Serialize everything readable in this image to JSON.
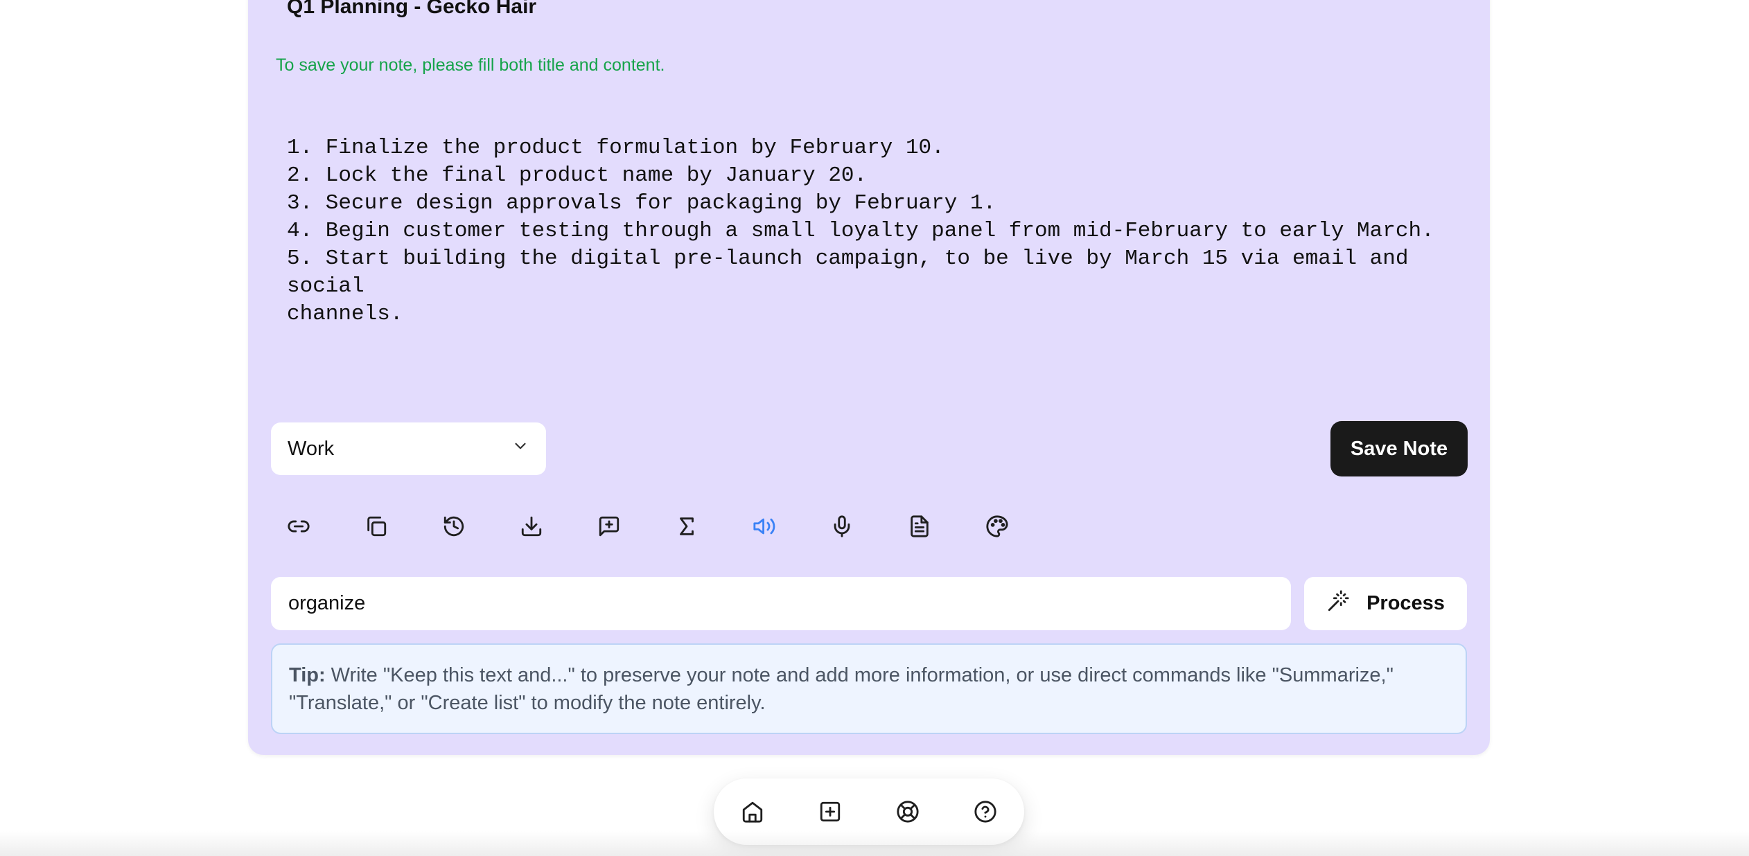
{
  "note": {
    "title": "Q1 Planning - Gecko Hair",
    "hint": "To save your note, please fill both title and content.",
    "content": "1. Finalize the product formulation by February 10.\n2. Lock the final product name by January 20.\n3. Secure design approvals for packaging by February 1.\n4. Begin customer testing through a small loyalty panel from mid-February to early March.\n5. Start building the digital pre-launch campaign, to be live by March 15 via email and social\nchannels."
  },
  "category": {
    "selected": "Work"
  },
  "actions": {
    "save_label": "Save Note"
  },
  "toolbar": {
    "tools": [
      {
        "icon": "link-icon"
      },
      {
        "icon": "copy-icon"
      },
      {
        "icon": "history-icon"
      },
      {
        "icon": "download-icon"
      },
      {
        "icon": "message-plus-icon"
      },
      {
        "icon": "sigma-icon"
      },
      {
        "icon": "speaker-icon",
        "active": true
      },
      {
        "icon": "microphone-icon"
      },
      {
        "icon": "document-icon"
      },
      {
        "icon": "palette-icon"
      }
    ],
    "active_color": "#3b82f6"
  },
  "command": {
    "value": "organize",
    "process_label": "Process"
  },
  "tip": {
    "label": "Tip:",
    "text": " Write \"Keep this text and...\" to preserve your note and add more information, or use direct commands like \"Summarize,\" \"Translate,\" or \"Create list\" to modify the note entirely."
  },
  "bottom_nav": {
    "items": [
      {
        "icon": "home-icon"
      },
      {
        "icon": "add-note-icon"
      },
      {
        "icon": "lifebuoy-icon"
      },
      {
        "icon": "help-icon"
      }
    ]
  },
  "colors": {
    "card_background": "#e3dcfd",
    "hint_green": "#16a34a",
    "save_button": "#1a1a1a",
    "tip_background": "#eef4ff"
  }
}
